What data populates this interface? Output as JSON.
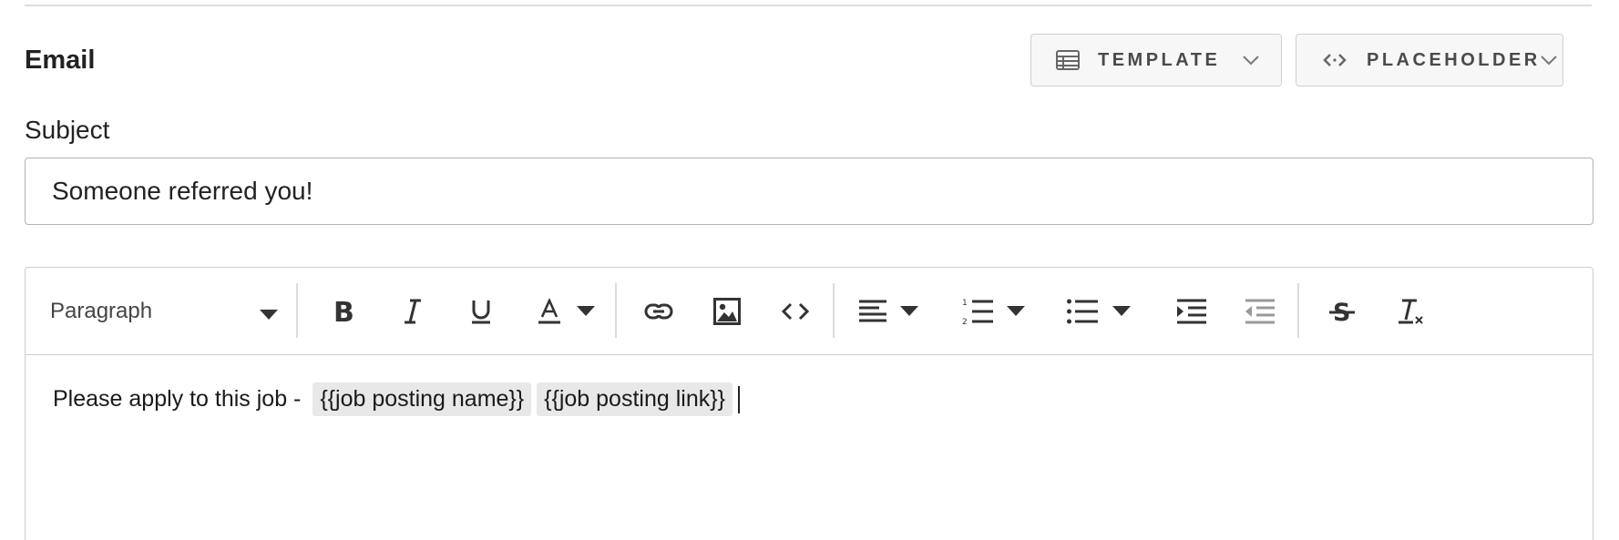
{
  "section": {
    "title": "Email"
  },
  "buttons": {
    "template": {
      "label": "TEMPLATE",
      "icon": "table-icon"
    },
    "placeholder": {
      "label": "PLACEHOLDER",
      "icon": "code-brackets-icon"
    }
  },
  "subject": {
    "label": "Subject",
    "value": "Someone referred you!"
  },
  "editor": {
    "block_format": "Paragraph",
    "toolbar": [
      "bold",
      "italic",
      "underline",
      "text-color",
      "link",
      "image",
      "code",
      "align",
      "numbered-list",
      "bulleted-list",
      "indent",
      "outdent",
      "strikethrough",
      "clear-formatting"
    ],
    "content": {
      "text": "Please apply to this job - ",
      "placeholders": [
        "{{job posting name}}",
        "{{job posting link}}"
      ]
    }
  },
  "colors": {
    "border": "#cfcfcf",
    "chip_bg": "#e8e8e8",
    "button_bg": "#f7f7f7",
    "text": "#222222"
  }
}
